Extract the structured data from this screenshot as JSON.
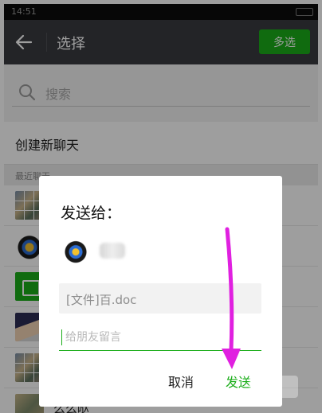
{
  "status_bar": {
    "time": "14:51"
  },
  "header": {
    "title": "选择",
    "multi_select_label": "多选"
  },
  "search": {
    "placeholder": "搜索"
  },
  "new_chat": {
    "label": "创建新聊天"
  },
  "recent_section": {
    "label": "最近聊天"
  },
  "list": {
    "visible_name_fragment": "么么哒"
  },
  "dialog": {
    "title": "发送给：",
    "file_label": "[文件]百.doc",
    "message_placeholder": "给朋友留言",
    "cancel_label": "取消",
    "send_label": "发送"
  },
  "colors": {
    "header_bg": "#393a3f",
    "accent_green": "#1aad19",
    "annotation_arrow": "#e020e0"
  }
}
